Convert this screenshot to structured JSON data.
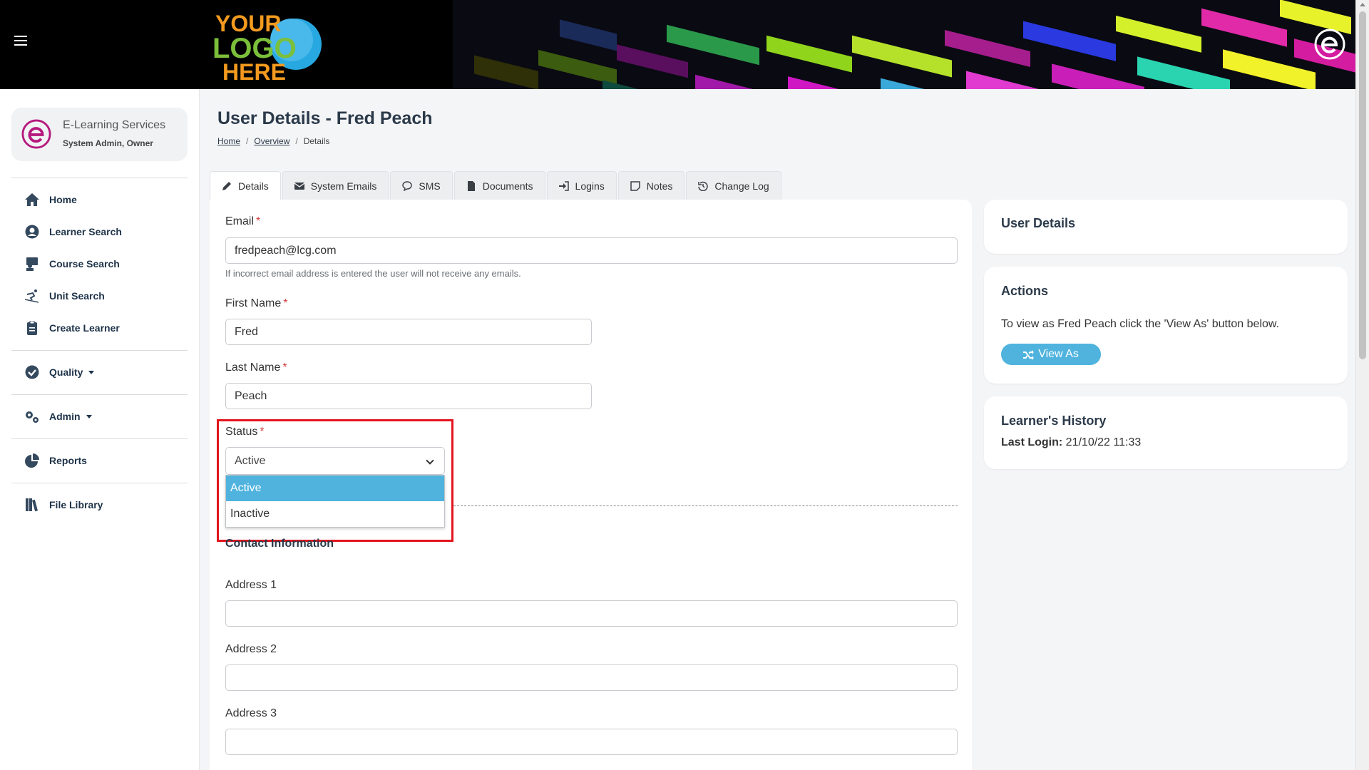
{
  "header": {
    "logo_text": [
      "YOUR",
      "LOGO",
      "HERE"
    ]
  },
  "sidebar": {
    "org_name": "E-Learning Services",
    "user_role": "System Admin, Owner",
    "items": [
      {
        "label": "Home",
        "icon": "home-icon"
      },
      {
        "label": "Learner Search",
        "icon": "user-circle-icon"
      },
      {
        "label": "Course Search",
        "icon": "teacher-icon"
      },
      {
        "label": "Unit Search",
        "icon": "skiing-icon"
      },
      {
        "label": "Create Learner",
        "icon": "clipboard-icon"
      },
      {
        "label": "Quality",
        "icon": "check-circle-icon"
      },
      {
        "label": "Admin",
        "icon": "cogs-icon"
      },
      {
        "label": "Reports",
        "icon": "pie-chart-icon"
      },
      {
        "label": "File Library",
        "icon": "books-icon"
      }
    ]
  },
  "page": {
    "title": "User Details - Fred Peach",
    "breadcrumb": [
      "Home",
      "Overview",
      "Details"
    ]
  },
  "tabs": [
    {
      "label": "Details",
      "icon": "pencil-icon",
      "active": true
    },
    {
      "label": "System Emails",
      "icon": "envelope-icon"
    },
    {
      "label": "SMS",
      "icon": "chat-icon"
    },
    {
      "label": "Documents",
      "icon": "file-icon"
    },
    {
      "label": "Logins",
      "icon": "sign-in-icon"
    },
    {
      "label": "Notes",
      "icon": "note-icon"
    },
    {
      "label": "Change Log",
      "icon": "history-icon"
    }
  ],
  "form": {
    "email_label": "Email",
    "email_value": "fredpeach@lcg.com",
    "email_hint": "If incorrect email address is entered the user will not receive any emails.",
    "first_name_label": "First Name",
    "first_name_value": "Fred",
    "last_name_label": "Last Name",
    "last_name_value": "Peach",
    "status_label": "Status",
    "status_value": "Active",
    "status_options": [
      "Active",
      "Inactive"
    ],
    "required_marker": "*",
    "contact_heading": "Contact Information",
    "address1_label": "Address 1",
    "address2_label": "Address 2",
    "address3_label": "Address 3"
  },
  "right": {
    "user_details_title": "User Details",
    "actions_title": "Actions",
    "actions_text": "To view as Fred Peach click the 'View As' button below.",
    "view_as_label": "View As",
    "history_title": "Learner's History",
    "last_login_label": "Last Login:",
    "last_login_value": "21/10/22 11:33"
  },
  "colors": {
    "accent": "#4fb3de",
    "highlight": "#e3141e",
    "brand_purple": "#b5197e",
    "required": "#d23a3a"
  }
}
